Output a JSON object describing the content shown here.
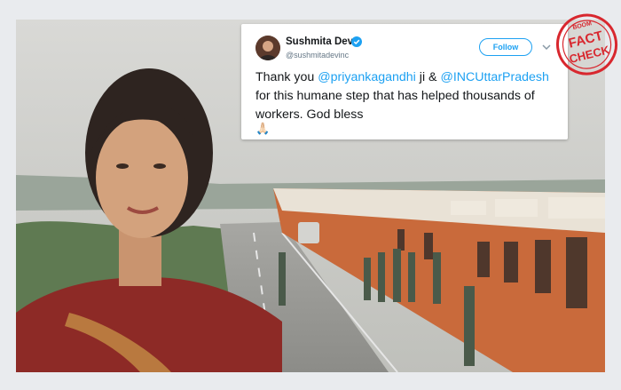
{
  "tweet": {
    "author_name": "Sushmita Dev",
    "author_handle": "@sushmitadevinc",
    "follow_label": "Follow",
    "text_part1": "Thank you ",
    "mention1": "@priyankagandhi",
    "text_part2": " ji & ",
    "mention2": "@INCUttarPradesh",
    "text_part3": " for this humane step that has helped thousands of workers. God bless",
    "emoji": "🙏🏻"
  },
  "stamp": {
    "brand": "BOOM",
    "line1": "FACT",
    "line2": "CHECK"
  },
  "colors": {
    "twitter_blue": "#1da1f2",
    "stamp_red": "#d8272e",
    "bus_orange": "#d9703a"
  },
  "icons": [
    "verified-icon",
    "chevron-down-icon",
    "folded-hands-emoji"
  ]
}
